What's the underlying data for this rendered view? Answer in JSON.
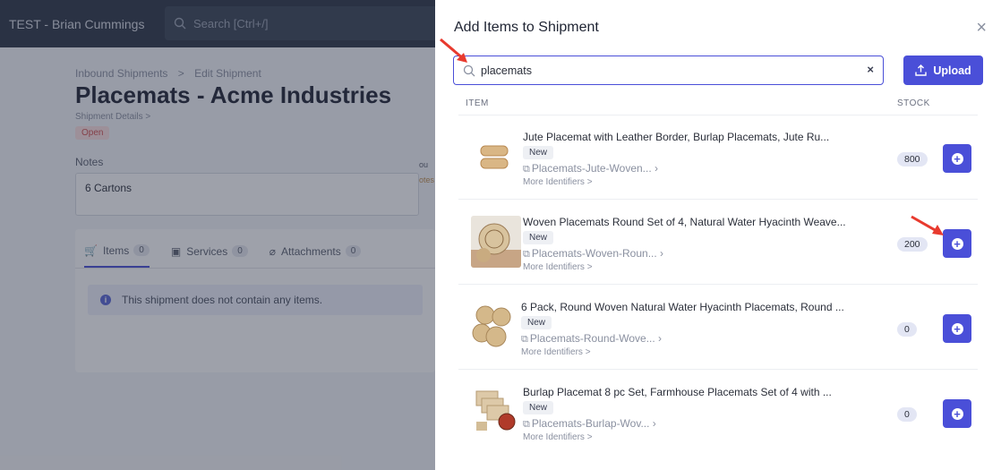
{
  "app": {
    "org_name": "TEST - Brian Cummings",
    "search_placeholder": "Search [Ctrl+/]"
  },
  "page": {
    "breadcrumb": [
      "Inbound Shipments",
      ">",
      "Edit Shipment"
    ],
    "title": "Placemats - Acme Industries",
    "details_link": "Shipment Details >",
    "status": "Open",
    "notes_label": "Notes",
    "notes_value": "6 Cartons",
    "side_text_1": "ou",
    "side_text_2": "otes",
    "tabs": [
      {
        "label": "Items",
        "count": "0",
        "icon": "cart-icon"
      },
      {
        "label": "Services",
        "count": "0",
        "icon": "services-icon"
      },
      {
        "label": "Attachments",
        "count": "0",
        "icon": "paperclip-icon"
      }
    ],
    "empty_message": "This shipment does not contain any items."
  },
  "modal": {
    "title": "Add Items to Shipment",
    "close": "×",
    "search_value": "placemats",
    "clear": "×",
    "upload_label": "Upload",
    "col_item": "ITEM",
    "col_stock": "STOCK",
    "more_identifiers": "More Identifiers >",
    "new_badge": "New",
    "items": [
      {
        "name": "Jute Placemat with Leather Border, Burlap Placemats, Jute Ru...",
        "sku": "Placemats-Jute-Woven...",
        "stock": "800"
      },
      {
        "name": "Woven Placemats Round Set of 4, Natural Water Hyacinth Weave...",
        "sku": "Placemats-Woven-Roun...",
        "stock": "200"
      },
      {
        "name": "6 Pack, Round Woven Natural Water Hyacinth Placemats, Round ...",
        "sku": "Placemats-Round-Wove...",
        "stock": "0"
      },
      {
        "name": "Burlap Placemat 8 pc Set, Farmhouse Placemats Set of 4 with ...",
        "sku": "Placemats-Burlap-Wov...",
        "stock": "0"
      }
    ]
  },
  "colors": {
    "accent": "#4a4fd8",
    "annotation_arrow": "#e83a2e"
  }
}
